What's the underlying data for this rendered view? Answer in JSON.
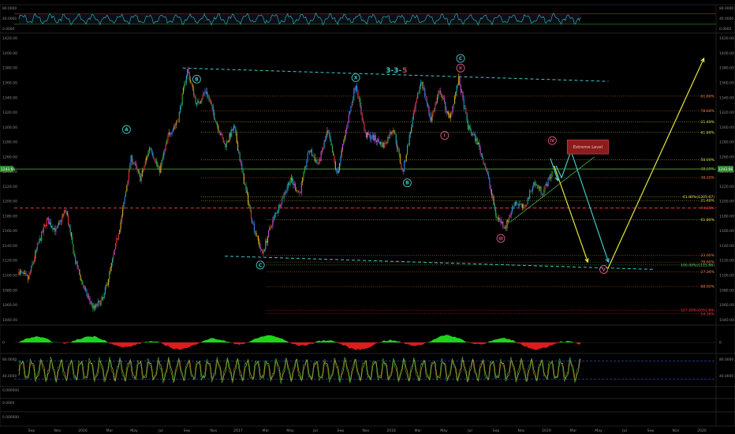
{
  "chart_data": [
    {
      "type": "line",
      "panel": "rsi-top",
      "series": [],
      "y_ticks": [
        "80.0000",
        "40.0000",
        "0.0000"
      ],
      "ylim": [
        0,
        100
      ],
      "levels": [
        70,
        30
      ],
      "line_color": "#26c6da"
    },
    {
      "type": "line",
      "panel": "price",
      "x_ticks": [
        "Sep",
        "Nov",
        "2016",
        "Mar",
        "May",
        "Jul",
        "Sep",
        "Nov",
        "2017",
        "Mar",
        "May",
        "Jul",
        "Sep",
        "Nov",
        "2018",
        "Mar",
        "May",
        "Jul",
        "Sep",
        "Nov",
        "2019",
        "Mar",
        "May",
        "Jul",
        "Sep",
        "Nov",
        "2020"
      ],
      "y_ticks": [
        "1420.00",
        "1400.00",
        "1380.00",
        "1360.00",
        "1340.00",
        "1320.00",
        "1300.00",
        "1280.00",
        "1260.00",
        "1240.00",
        "1220.00",
        "1200.00",
        "1180.00",
        "1160.00",
        "1140.00",
        "1120.00",
        "1100.00",
        "1080.00",
        "1060.00",
        "1040.00"
      ],
      "ylim": [
        1035,
        1425
      ],
      "current_price_label": "1243.66",
      "pivots": [
        {
          "t": 0,
          "p": 1105
        },
        {
          "t": 1,
          "p": 1095
        },
        {
          "t": 2,
          "p": 1140
        },
        {
          "t": 3,
          "p": 1175
        },
        {
          "t": 4,
          "p": 1160
        },
        {
          "t": 5,
          "p": 1190
        },
        {
          "t": 6,
          "p": 1120
        },
        {
          "t": 7,
          "p": 1080
        },
        {
          "t": 8,
          "p": 1055
        },
        {
          "t": 9,
          "p": 1068
        },
        {
          "t": 10,
          "p": 1120
        },
        {
          "t": 11,
          "p": 1180
        },
        {
          "t": 12,
          "p": 1260
        },
        {
          "t": 13,
          "p": 1230
        },
        {
          "t": 14,
          "p": 1275
        },
        {
          "t": 15,
          "p": 1240
        },
        {
          "t": 16,
          "p": 1290
        },
        {
          "t": 17,
          "p": 1310
        },
        {
          "t": 18,
          "p": 1378
        },
        {
          "t": 19,
          "p": 1330
        },
        {
          "t": 20,
          "p": 1350
        },
        {
          "t": 21,
          "p": 1310
        },
        {
          "t": 22,
          "p": 1275
        },
        {
          "t": 23,
          "p": 1300
        },
        {
          "t": 24,
          "p": 1230
        },
        {
          "t": 25,
          "p": 1170
        },
        {
          "t": 26,
          "p": 1128
        },
        {
          "t": 27,
          "p": 1170
        },
        {
          "t": 28,
          "p": 1200
        },
        {
          "t": 29,
          "p": 1230
        },
        {
          "t": 30,
          "p": 1210
        },
        {
          "t": 31,
          "p": 1270
        },
        {
          "t": 32,
          "p": 1250
        },
        {
          "t": 33,
          "p": 1295
        },
        {
          "t": 34,
          "p": 1235
        },
        {
          "t": 35,
          "p": 1300
        },
        {
          "t": 36,
          "p": 1360
        },
        {
          "t": 37,
          "p": 1290
        },
        {
          "t": 38,
          "p": 1285
        },
        {
          "t": 39,
          "p": 1275
        },
        {
          "t": 40,
          "p": 1300
        },
        {
          "t": 41,
          "p": 1238
        },
        {
          "t": 42,
          "p": 1305
        },
        {
          "t": 43,
          "p": 1365
        },
        {
          "t": 44,
          "p": 1310
        },
        {
          "t": 45,
          "p": 1350
        },
        {
          "t": 46,
          "p": 1310
        },
        {
          "t": 47,
          "p": 1365
        },
        {
          "t": 48,
          "p": 1300
        },
        {
          "t": 49,
          "p": 1280
        },
        {
          "t": 50,
          "p": 1240
        },
        {
          "t": 51,
          "p": 1180
        },
        {
          "t": 52,
          "p": 1165
        },
        {
          "t": 53,
          "p": 1200
        },
        {
          "t": 54,
          "p": 1190
        },
        {
          "t": 55,
          "p": 1225
        },
        {
          "t": 56,
          "p": 1212
        },
        {
          "t": 57,
          "p": 1240
        }
      ],
      "fib_levels": [
        {
          "label": "61.80%",
          "value": 1342
        },
        {
          "label": "78.60%",
          "value": 1322
        },
        {
          "label": "21.40%",
          "value": 1307
        },
        {
          "label": "61.80%",
          "value": 1293
        },
        {
          "label": "50.00%",
          "value": 1256
        },
        {
          "label": "38.20%",
          "value": 1244
        },
        {
          "label": "38.20%",
          "value": 1232
        },
        {
          "label": "61.80%(1205.67)",
          "value": 1206
        },
        {
          "label": "21.40%",
          "value": 1201
        },
        {
          "label": "94.38%",
          "value": 1191
        },
        {
          "label": "61.80%",
          "value": 1175
        },
        {
          "label": "23.60%",
          "value": 1127
        },
        {
          "label": "78.60%",
          "value": 1118
        },
        {
          "label": "100.00%(1115.66)",
          "value": 1114
        },
        {
          "label": "27.28%",
          "value": 1105
        },
        {
          "label": "88.60%",
          "value": 1085
        },
        {
          "label": "127.20%(1052.84)",
          "value": 1053
        },
        {
          "label": "54.16%",
          "value": 1048
        }
      ],
      "wave_labels": [
        {
          "text": "A",
          "t": 11.5,
          "p": 1297
        },
        {
          "text": "B",
          "t": 19.0,
          "p": 1365
        },
        {
          "text": "C",
          "t": 25.8,
          "p": 1114
        },
        {
          "text": "X",
          "t": 36.0,
          "p": 1367
        },
        {
          "text": "B",
          "t": 41.5,
          "p": 1225
        },
        {
          "text": "I",
          "t": 45.5,
          "p": 1289
        },
        {
          "text": "C",
          "t": 47.2,
          "p": 1393
        },
        {
          "text": "II",
          "t": 47.2,
          "p": 1380
        },
        {
          "text": "III",
          "t": 51.5,
          "p": 1150
        },
        {
          "text": "IV",
          "t": 57.0,
          "p": 1282
        },
        {
          "text": "V",
          "t": 62.5,
          "p": 1108
        }
      ],
      "pattern_label": {
        "text_a": "3-3-",
        "text_b": "5"
      },
      "extreme_box_label": "Extreme Level",
      "resistance_line": [
        {
          "t": 17.5,
          "p": 1380
        },
        {
          "t": 63,
          "p": 1362
        }
      ],
      "support_line": [
        {
          "t": 22,
          "p": 1126
        },
        {
          "t": 68,
          "p": 1108
        }
      ],
      "red_level": 1191,
      "green_level": 1243.66,
      "forecast_yellow": [
        {
          "t": 57.2,
          "p": 1248
        },
        {
          "t": 60.8,
          "p": 1118
        }
      ],
      "forecast_teal": [
        {
          "t": 57.4,
          "p": 1248
        },
        {
          "t": 58.0,
          "p": 1232
        },
        {
          "t": 59.0,
          "p": 1268
        },
        {
          "t": 63.0,
          "p": 1118
        }
      ],
      "forecast_yellow_up": [
        {
          "t": 62.9,
          "p": 1108
        },
        {
          "t": 73.2,
          "p": 1393
        }
      ]
    },
    {
      "type": "area",
      "panel": "macd-histogram",
      "y_ticks": [
        "0"
      ],
      "positive_color": "#1bd61b",
      "negative_color": "#e01b1b"
    },
    {
      "type": "line",
      "panel": "stochastic",
      "y_ticks": [
        "80.0000",
        "40.0000"
      ],
      "ylim": [
        0,
        100
      ],
      "levels": [
        80,
        20
      ]
    },
    {
      "type": "line",
      "panel": "empty-1",
      "y_ticks": [
        "0.000000"
      ]
    },
    {
      "type": "line",
      "panel": "empty-2",
      "y_ticks": [
        "0.0000"
      ]
    },
    {
      "type": "line",
      "panel": "empty-3",
      "y_ticks": [
        "0.000000"
      ]
    }
  ]
}
